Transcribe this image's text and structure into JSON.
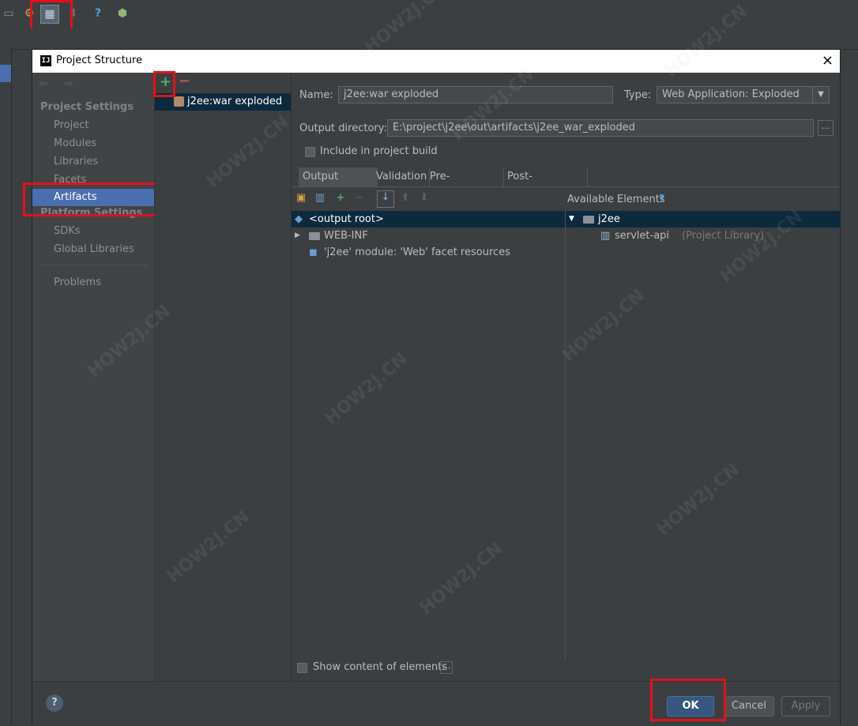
{
  "dialog": {
    "title": "Project Structure",
    "close_glyph": "×",
    "app_icon_text": "IJ"
  },
  "nav": {
    "back_forward": "⇦ ⇨",
    "project_settings_header": "Project Settings",
    "items": [
      {
        "label": "Project"
      },
      {
        "label": "Modules"
      },
      {
        "label": "Libraries"
      },
      {
        "label": "Facets"
      },
      {
        "label": "Artifacts",
        "selected": true
      }
    ],
    "platform_settings_header": "Platform Settings",
    "platform_items": [
      {
        "label": "SDKs"
      },
      {
        "label": "Global Libraries"
      }
    ],
    "problems_label": "Problems"
  },
  "artifacts_panel": {
    "add_glyph": "+",
    "remove_glyph": "−",
    "selected_artifact": "j2ee:war exploded"
  },
  "form": {
    "name_label": "Name:",
    "name_value": "j2ee:war exploded",
    "type_label": "Type:",
    "type_value": "Web Application: Exploded",
    "output_dir_label": "Output directory:",
    "output_dir_value": "E:\\project\\j2ee\\out\\artifacts\\j2ee_war_exploded",
    "browse_glyph": "...",
    "include_build_label": "Include in project build",
    "include_build_checked": false
  },
  "tabs": [
    "Output Layout",
    "Validation",
    "Pre-processing",
    "Post-processing"
  ],
  "layout": {
    "available_elements_label": "Available Elements",
    "help_glyph": "?",
    "left_tree": [
      {
        "label": "<output root>",
        "selected": true
      },
      {
        "label": "WEB-INF",
        "expander": "▶"
      },
      {
        "label": "'j2ee' module: 'Web' facet resources"
      }
    ],
    "right_tree": [
      {
        "label": "j2ee",
        "expander": "▼"
      },
      {
        "label": "servlet-api",
        "suffix": "(Project Library)"
      }
    ],
    "show_content_label": "Show content of elements",
    "show_content_dots": "..."
  },
  "buttons": {
    "help": "?",
    "ok": "OK",
    "cancel": "Cancel",
    "apply": "Apply"
  },
  "watermark_text": "HOW2J.CN",
  "colors": {
    "accent_selected": "#4b6eaf",
    "highlight_box": "#e3101b",
    "ok_button": "#365880"
  }
}
